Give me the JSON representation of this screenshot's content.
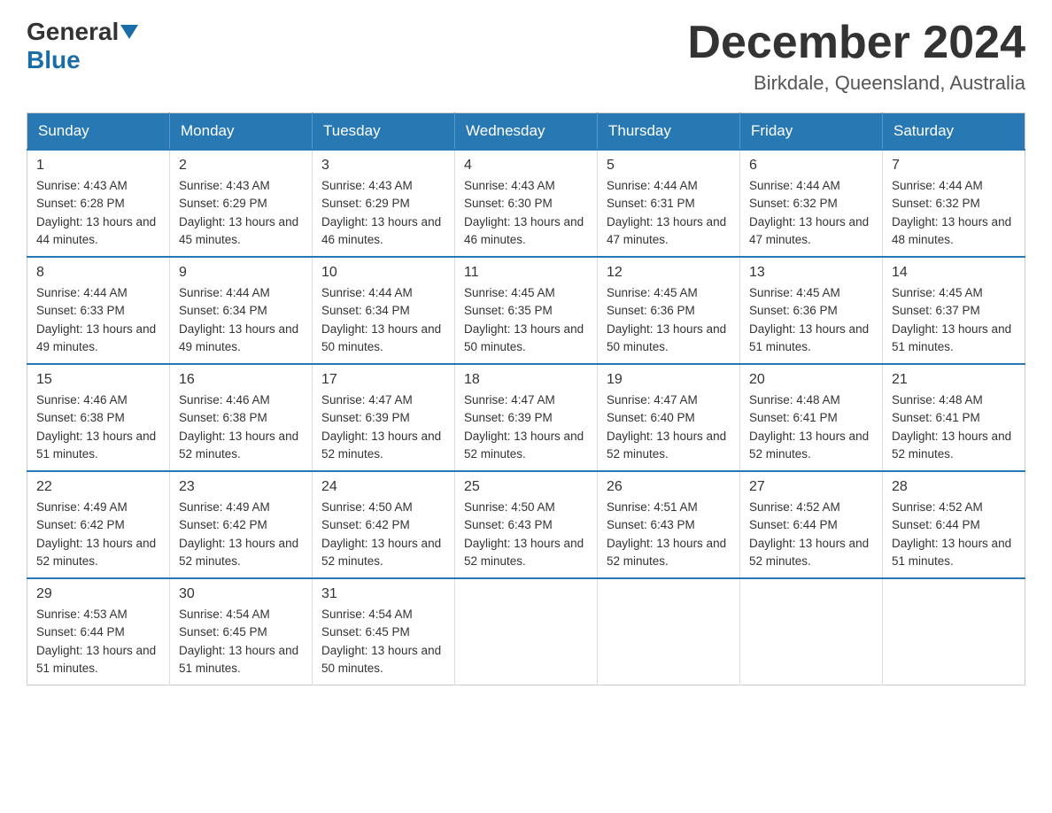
{
  "logo": {
    "general": "General",
    "blue": "Blue"
  },
  "title": "December 2024",
  "location": "Birkdale, Queensland, Australia",
  "headers": [
    "Sunday",
    "Monday",
    "Tuesday",
    "Wednesday",
    "Thursday",
    "Friday",
    "Saturday"
  ],
  "rows": [
    [
      {
        "day": "1",
        "sunrise": "4:43 AM",
        "sunset": "6:28 PM",
        "daylight": "13 hours and 44 minutes."
      },
      {
        "day": "2",
        "sunrise": "4:43 AM",
        "sunset": "6:29 PM",
        "daylight": "13 hours and 45 minutes."
      },
      {
        "day": "3",
        "sunrise": "4:43 AM",
        "sunset": "6:29 PM",
        "daylight": "13 hours and 46 minutes."
      },
      {
        "day": "4",
        "sunrise": "4:43 AM",
        "sunset": "6:30 PM",
        "daylight": "13 hours and 46 minutes."
      },
      {
        "day": "5",
        "sunrise": "4:44 AM",
        "sunset": "6:31 PM",
        "daylight": "13 hours and 47 minutes."
      },
      {
        "day": "6",
        "sunrise": "4:44 AM",
        "sunset": "6:32 PM",
        "daylight": "13 hours and 47 minutes."
      },
      {
        "day": "7",
        "sunrise": "4:44 AM",
        "sunset": "6:32 PM",
        "daylight": "13 hours and 48 minutes."
      }
    ],
    [
      {
        "day": "8",
        "sunrise": "4:44 AM",
        "sunset": "6:33 PM",
        "daylight": "13 hours and 49 minutes."
      },
      {
        "day": "9",
        "sunrise": "4:44 AM",
        "sunset": "6:34 PM",
        "daylight": "13 hours and 49 minutes."
      },
      {
        "day": "10",
        "sunrise": "4:44 AM",
        "sunset": "6:34 PM",
        "daylight": "13 hours and 50 minutes."
      },
      {
        "day": "11",
        "sunrise": "4:45 AM",
        "sunset": "6:35 PM",
        "daylight": "13 hours and 50 minutes."
      },
      {
        "day": "12",
        "sunrise": "4:45 AM",
        "sunset": "6:36 PM",
        "daylight": "13 hours and 50 minutes."
      },
      {
        "day": "13",
        "sunrise": "4:45 AM",
        "sunset": "6:36 PM",
        "daylight": "13 hours and 51 minutes."
      },
      {
        "day": "14",
        "sunrise": "4:45 AM",
        "sunset": "6:37 PM",
        "daylight": "13 hours and 51 minutes."
      }
    ],
    [
      {
        "day": "15",
        "sunrise": "4:46 AM",
        "sunset": "6:38 PM",
        "daylight": "13 hours and 51 minutes."
      },
      {
        "day": "16",
        "sunrise": "4:46 AM",
        "sunset": "6:38 PM",
        "daylight": "13 hours and 52 minutes."
      },
      {
        "day": "17",
        "sunrise": "4:47 AM",
        "sunset": "6:39 PM",
        "daylight": "13 hours and 52 minutes."
      },
      {
        "day": "18",
        "sunrise": "4:47 AM",
        "sunset": "6:39 PM",
        "daylight": "13 hours and 52 minutes."
      },
      {
        "day": "19",
        "sunrise": "4:47 AM",
        "sunset": "6:40 PM",
        "daylight": "13 hours and 52 minutes."
      },
      {
        "day": "20",
        "sunrise": "4:48 AM",
        "sunset": "6:41 PM",
        "daylight": "13 hours and 52 minutes."
      },
      {
        "day": "21",
        "sunrise": "4:48 AM",
        "sunset": "6:41 PM",
        "daylight": "13 hours and 52 minutes."
      }
    ],
    [
      {
        "day": "22",
        "sunrise": "4:49 AM",
        "sunset": "6:42 PM",
        "daylight": "13 hours and 52 minutes."
      },
      {
        "day": "23",
        "sunrise": "4:49 AM",
        "sunset": "6:42 PM",
        "daylight": "13 hours and 52 minutes."
      },
      {
        "day": "24",
        "sunrise": "4:50 AM",
        "sunset": "6:42 PM",
        "daylight": "13 hours and 52 minutes."
      },
      {
        "day": "25",
        "sunrise": "4:50 AM",
        "sunset": "6:43 PM",
        "daylight": "13 hours and 52 minutes."
      },
      {
        "day": "26",
        "sunrise": "4:51 AM",
        "sunset": "6:43 PM",
        "daylight": "13 hours and 52 minutes."
      },
      {
        "day": "27",
        "sunrise": "4:52 AM",
        "sunset": "6:44 PM",
        "daylight": "13 hours and 52 minutes."
      },
      {
        "day": "28",
        "sunrise": "4:52 AM",
        "sunset": "6:44 PM",
        "daylight": "13 hours and 51 minutes."
      }
    ],
    [
      {
        "day": "29",
        "sunrise": "4:53 AM",
        "sunset": "6:44 PM",
        "daylight": "13 hours and 51 minutes."
      },
      {
        "day": "30",
        "sunrise": "4:54 AM",
        "sunset": "6:45 PM",
        "daylight": "13 hours and 51 minutes."
      },
      {
        "day": "31",
        "sunrise": "4:54 AM",
        "sunset": "6:45 PM",
        "daylight": "13 hours and 50 minutes."
      },
      null,
      null,
      null,
      null
    ]
  ]
}
